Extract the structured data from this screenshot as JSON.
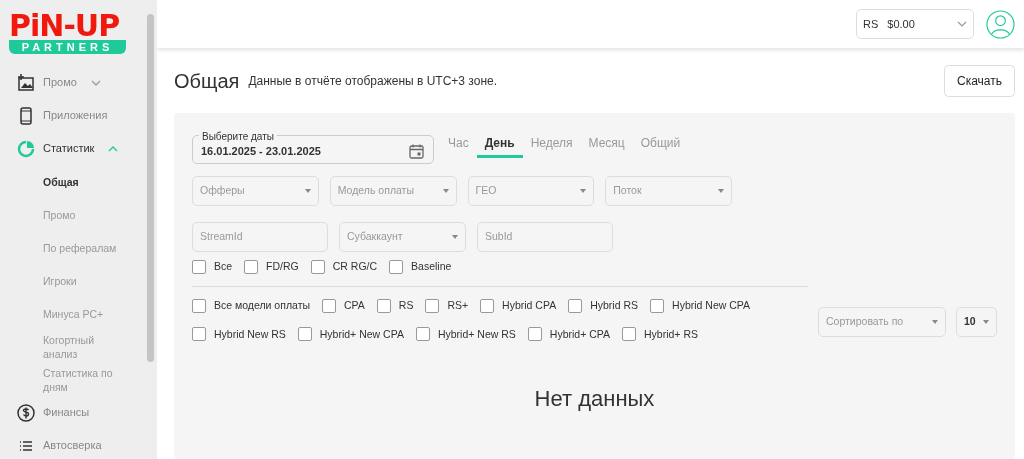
{
  "sidebar": {
    "logo": {
      "top": "PiN-UP",
      "bottom": "PARTNERS"
    },
    "items": [
      {
        "label": "Промо",
        "expanded": false,
        "selected": false
      },
      {
        "label": "Приложения",
        "selected": false
      },
      {
        "label": "Статистик",
        "expanded": true,
        "selected": true,
        "children": [
          {
            "label": "Общая",
            "selected": true
          },
          {
            "label": "Промо",
            "selected": false
          },
          {
            "label": "По рефералам",
            "selected": false
          },
          {
            "label": "Игроки",
            "selected": false
          },
          {
            "label": "Минуса РС+",
            "selected": false
          },
          {
            "label": "Когортный анализ",
            "selected": false
          },
          {
            "label": "Статистика по дням",
            "selected": false
          }
        ]
      },
      {
        "label": "Финансы",
        "selected": false
      },
      {
        "label": "Автосверка",
        "selected": false
      }
    ]
  },
  "header": {
    "balance": {
      "currency": "RS",
      "amount": "$0.00"
    }
  },
  "page": {
    "title": "Общая",
    "note": "Данные в отчёте отображены в UTC+3 зоне.",
    "download": "Скачать"
  },
  "date_picker": {
    "label": "Выберите даты",
    "value": "16.01.2025 - 23.01.2025"
  },
  "period_tabs": [
    {
      "label": "Час",
      "selected": false
    },
    {
      "label": "День",
      "selected": true
    },
    {
      "label": "Неделя",
      "selected": false
    },
    {
      "label": "Месяц",
      "selected": false
    },
    {
      "label": "Общий",
      "selected": false
    }
  ],
  "filter_rows": [
    [
      {
        "kind": "select",
        "placeholder": "Офферы"
      },
      {
        "kind": "select",
        "placeholder": "Модель оплаты"
      },
      {
        "kind": "select",
        "placeholder": "ГЕО"
      },
      {
        "kind": "select",
        "placeholder": "Поток"
      }
    ],
    [
      {
        "kind": "input",
        "placeholder": "StreamId"
      },
      {
        "kind": "select",
        "placeholder": "Субаккаунт"
      },
      {
        "kind": "input",
        "placeholder": "SubId"
      }
    ]
  ],
  "metric_checks": [
    {
      "label": "Все",
      "checked": false
    },
    {
      "label": "FD/RG",
      "checked": false
    },
    {
      "label": "CR RG/C",
      "checked": false
    },
    {
      "label": "Baseline",
      "checked": false
    }
  ],
  "model_checks": [
    {
      "label": "Все модели оплаты",
      "checked": false
    },
    {
      "label": "CPA",
      "checked": false
    },
    {
      "label": "RS",
      "checked": false
    },
    {
      "label": "RS+",
      "checked": false
    },
    {
      "label": "Hybrid CPA",
      "checked": false
    },
    {
      "label": "Hybrid RS",
      "checked": false
    },
    {
      "label": "Hybrid New CPA",
      "checked": false
    },
    {
      "label": "Hybrid New RS",
      "checked": false
    },
    {
      "label": "Hybrid+ New CPA",
      "checked": false
    },
    {
      "label": "Hybrid+ New RS",
      "checked": false
    },
    {
      "label": "Hybrid+ CPA",
      "checked": false
    },
    {
      "label": "Hybrid+ RS",
      "checked": false
    }
  ],
  "sort": {
    "placeholder": "Сортировать по"
  },
  "page_size": {
    "value": "10"
  },
  "empty_message": "Нет данных"
}
